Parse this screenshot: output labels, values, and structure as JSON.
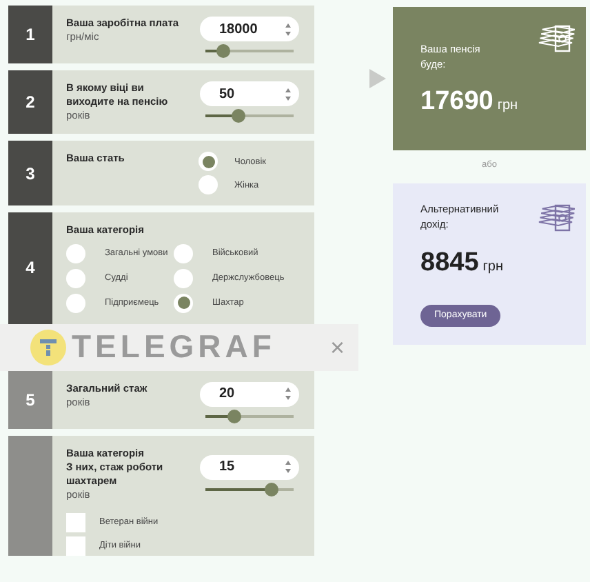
{
  "steps": [
    {
      "number": "1",
      "kind": "number",
      "dimmed": false,
      "title": "Ваша заробітна плата",
      "unit": "грн/міс",
      "field": {
        "value": "18000",
        "level": 0.2
      }
    },
    {
      "number": "2",
      "kind": "number",
      "dimmed": false,
      "title": "В якому віці ви виходите на пенсію",
      "unit": "років",
      "field": {
        "value": "50",
        "level": 0.38
      }
    },
    {
      "number": "3",
      "kind": "radio",
      "dimmed": false,
      "title": "Ваша стать",
      "options": [
        {
          "label": "Чоловік",
          "selected": true
        },
        {
          "label": "Жінка",
          "selected": false
        }
      ]
    },
    {
      "number": "4",
      "kind": "radio-grid",
      "dimmed": false,
      "title": "Ваша категорія",
      "options": [
        {
          "label": "Загальні умови",
          "selected": false
        },
        {
          "label": "Військовий",
          "selected": false
        },
        {
          "label": "Судді",
          "selected": false
        },
        {
          "label": "Держслужбовець",
          "selected": false
        },
        {
          "label": "Підприємець",
          "selected": false
        },
        {
          "label": "Шахтар",
          "selected": true
        }
      ]
    },
    {
      "kind": "banner",
      "logo_text": "TELEGRAF",
      "close": "×"
    },
    {
      "number": "5",
      "kind": "number",
      "dimmed": true,
      "title": "Загальний стаж",
      "unit": "років",
      "field": {
        "value": "20",
        "level": 0.33
      }
    },
    {
      "kind": "number",
      "dimmed": true,
      "title": "Ваша категорія",
      "subtitle": "З них, стаж роботи шахтарем",
      "unit": "років",
      "field": {
        "value": "15",
        "level": 0.75
      },
      "checks": [
        {
          "label": "Ветеран війни",
          "checked": false
        },
        {
          "label": "Діти війни",
          "checked": false
        }
      ]
    }
  ],
  "result": {
    "title": "Ваша пенсія буде:",
    "amount": "17690",
    "currency": "грн"
  },
  "separator": "або",
  "alternative": {
    "title": "Альтернативний дохід:",
    "amount": "8845",
    "currency": "грн",
    "button": "Порахувати"
  }
}
